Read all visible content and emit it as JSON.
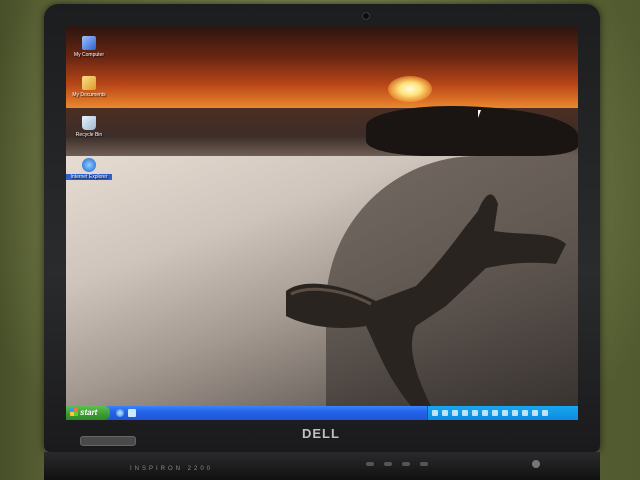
{
  "device": {
    "brand": "DELL",
    "model": "INSPIRON 2200"
  },
  "desktop": {
    "icons": [
      {
        "label": "My Computer",
        "icon": "my-computer-icon"
      },
      {
        "label": "My Documents",
        "icon": "my-documents-icon"
      },
      {
        "label": "Recycle Bin",
        "icon": "recycle-bin-icon"
      },
      {
        "label": "Internet Explorer",
        "icon": "internet-explorer-icon"
      }
    ],
    "wallpaper": "sunset-beach-driftwood"
  },
  "taskbar": {
    "start_label": "start",
    "quick_launch": [
      "internet-explorer-icon",
      "show-desktop-icon"
    ],
    "tray_icon_count": 12
  },
  "colors": {
    "taskbar": "#2464e8",
    "start_button": "#3b9a32",
    "tray": "#0d8be0"
  }
}
